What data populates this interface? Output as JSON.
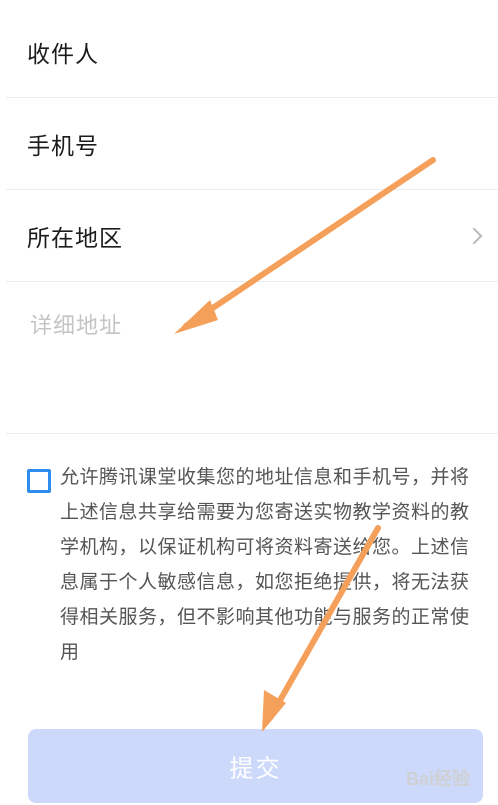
{
  "form": {
    "recipient_label": "收件人",
    "phone_label": "手机号",
    "region_label": "所在地区",
    "address_placeholder": "详细地址"
  },
  "consent": {
    "checked": false,
    "text": "允许腾讯课堂收集您的地址信息和手机号，并将上述信息共享给需要为您寄送实物教学资料的教学机构，以保证机构可将资料寄送给您。上述信息属于个人敏感信息，如您拒绝提供，将无法获得相关服务，但不影响其他功能与服务的正常使用"
  },
  "submit": {
    "label": "提交"
  },
  "watermark": {
    "text": "Bai经验"
  },
  "colors": {
    "checkbox_border": "#2d8cf0",
    "submit_bg": "#cdd9fb",
    "annotation_arrow": "#f5a05a"
  }
}
